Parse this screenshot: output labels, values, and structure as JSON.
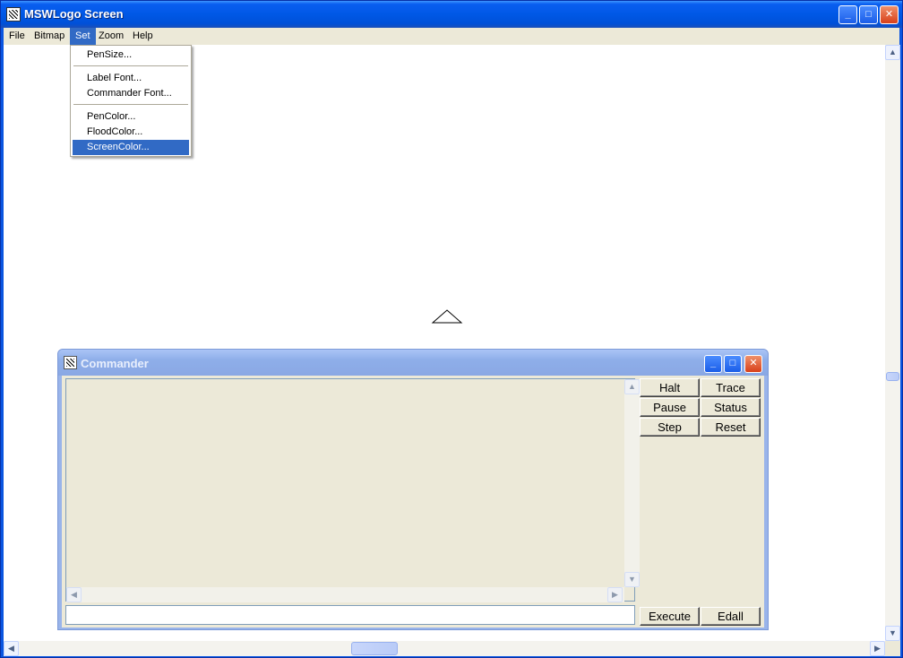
{
  "window": {
    "title": "MSWLogo Screen",
    "icon": "logo-icon",
    "controls": {
      "minimize": "_",
      "maximize": "□",
      "close": "✕"
    }
  },
  "menubar": {
    "items": [
      {
        "label": "File"
      },
      {
        "label": "Bitmap"
      },
      {
        "label": "Set",
        "active": true
      },
      {
        "label": "Zoom"
      },
      {
        "label": "Help"
      }
    ]
  },
  "set_menu": {
    "items": [
      {
        "label": "PenSize..."
      },
      {
        "label": "Label Font..."
      },
      {
        "label": "Commander Font..."
      },
      {
        "label": "PenColor..."
      },
      {
        "label": "FloodColor..."
      },
      {
        "label": "ScreenColor...",
        "highlighted": true
      }
    ]
  },
  "scrollbars": {
    "up_arrow": "▲",
    "down_arrow": "▼",
    "left_arrow": "◀",
    "right_arrow": "▶"
  },
  "commander": {
    "title": "Commander",
    "controls": {
      "minimize": "_",
      "maximize": "□",
      "close": "✕"
    },
    "input_value": "",
    "buttons": {
      "halt": "Halt",
      "trace": "Trace",
      "pause": "Pause",
      "status": "Status",
      "step": "Step",
      "reset": "Reset",
      "execute": "Execute",
      "edall": "Edall"
    }
  },
  "colors": {
    "titlebar": "#0058e6",
    "menu_highlight": "#316ac5",
    "canvas": "#ffffff",
    "commander_inactive_title": "#8eaee9"
  }
}
